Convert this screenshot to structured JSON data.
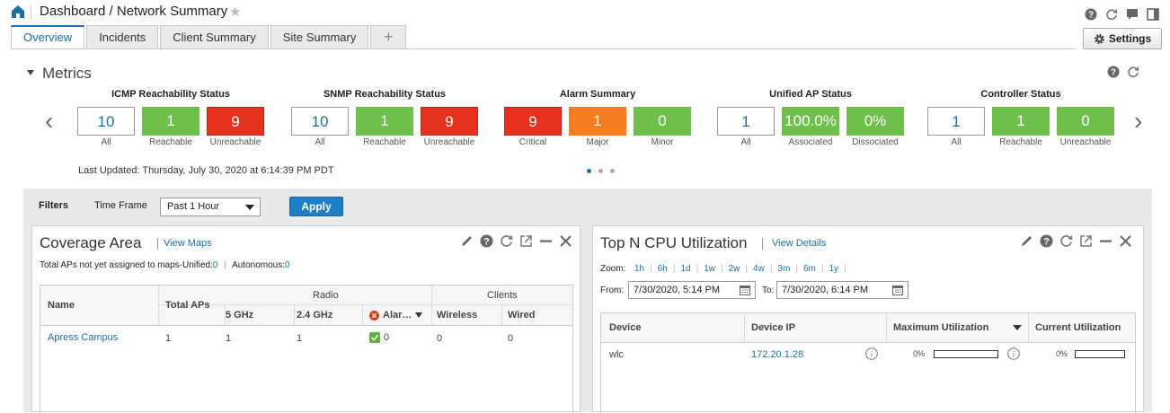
{
  "header": {
    "breadcrumb": "Dashboard / Network Summary",
    "settings_label": "Settings"
  },
  "tabs": [
    {
      "label": "Overview",
      "active": true
    },
    {
      "label": "Incidents"
    },
    {
      "label": "Client Summary"
    },
    {
      "label": "Site Summary"
    },
    {
      "label": "+"
    }
  ],
  "metrics": {
    "title": "Metrics",
    "last_updated": "Last Updated: Thursday, July 30, 2020 at 6:14:39 PM PDT",
    "groups": [
      {
        "title": "ICMP Reachability Status",
        "tiles": [
          {
            "value": "10",
            "label": "All",
            "color": "white"
          },
          {
            "value": "1",
            "label": "Reachable",
            "color": "green"
          },
          {
            "value": "9",
            "label": "Unreachable",
            "color": "red"
          }
        ]
      },
      {
        "title": "SNMP Reachability Status",
        "tiles": [
          {
            "value": "10",
            "label": "All",
            "color": "white"
          },
          {
            "value": "1",
            "label": "Reachable",
            "color": "green"
          },
          {
            "value": "9",
            "label": "Unreachable",
            "color": "red"
          }
        ]
      },
      {
        "title": "Alarm Summary",
        "tiles": [
          {
            "value": "9",
            "label": "Critical",
            "color": "red"
          },
          {
            "value": "1",
            "label": "Major",
            "color": "orange"
          },
          {
            "value": "0",
            "label": "Minor",
            "color": "green"
          }
        ]
      },
      {
        "title": "Unified AP Status",
        "tiles": [
          {
            "value": "1",
            "label": "All",
            "color": "white"
          },
          {
            "value": "100.0%",
            "label": "Associated",
            "color": "green"
          },
          {
            "value": "0%",
            "label": "Dissociated",
            "color": "green"
          }
        ]
      },
      {
        "title": "Controller Status",
        "tiles": [
          {
            "value": "1",
            "label": "All",
            "color": "white"
          },
          {
            "value": "1",
            "label": "Reachable",
            "color": "green"
          },
          {
            "value": "0",
            "label": "Unreachable",
            "color": "green"
          }
        ]
      }
    ]
  },
  "filters": {
    "label": "Filters",
    "time_frame_label": "Time Frame",
    "time_frame_value": "Past 1 Hour",
    "apply_label": "Apply"
  },
  "coverage": {
    "title": "Coverage Area",
    "link": "View Maps",
    "note_prefix": "Total APs not yet assigned to maps-Unified:",
    "note_unified_count": "0",
    "note_autonomous_label": "Autonomous:",
    "note_autonomous_count": "0",
    "headers": {
      "name": "Name",
      "total_aps": "Total APs",
      "radio": "Radio",
      "clients": "Clients",
      "ghz5": "5 GHz",
      "ghz24": "2.4 GHz",
      "alarms": "Alar…",
      "wireless": "Wireless",
      "wired": "Wired"
    },
    "rows": [
      {
        "name": "Apress Campus",
        "total_aps": "1",
        "ghz5": "1",
        "ghz24": "1",
        "alarms": "0",
        "wireless": "0",
        "wired": "0"
      }
    ]
  },
  "cpu": {
    "title": "Top N CPU Utilization",
    "link": "View Details",
    "zoom_label": "Zoom:",
    "zoom_options": [
      "1h",
      "6h",
      "1d",
      "1w",
      "2w",
      "4w",
      "3m",
      "6m",
      "1y"
    ],
    "from_label": "From:",
    "from_value": "7/30/2020, 5:14 PM",
    "to_label": "To:",
    "to_value": "7/30/2020, 6:14 PM",
    "headers": {
      "device": "Device",
      "ip": "Device IP",
      "max": "Maximum Utilization",
      "current": "Current Utilization"
    },
    "rows": [
      {
        "device": "wlc",
        "ip": "172.20.1.28",
        "max": "0%",
        "current": "0%",
        "max_value": 0,
        "current_value": 0
      }
    ]
  },
  "colors": {
    "accent": "#1d6fa5",
    "green": "#6ebf4b",
    "red": "#e8321f",
    "orange": "#f57c20",
    "apply": "#1f7fc4"
  }
}
